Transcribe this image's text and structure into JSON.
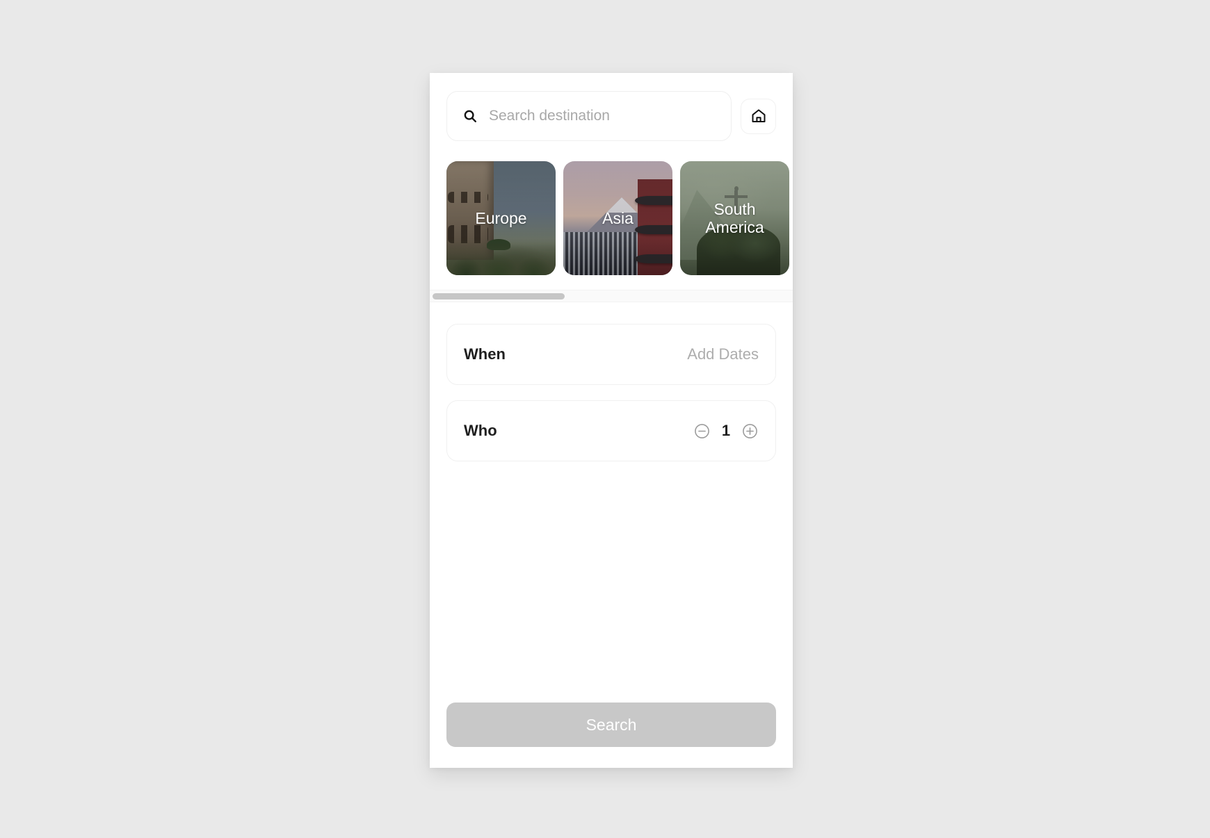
{
  "search": {
    "placeholder": "Search destination",
    "value": "",
    "icon": "search-icon",
    "home_icon": "home-icon"
  },
  "destinations": {
    "items": [
      {
        "label": "Europe",
        "photo": "colosseum-rome"
      },
      {
        "label": "Asia",
        "photo": "mount-fuji-pagoda"
      },
      {
        "label": "South America",
        "photo": "christ-the-redeemer-rio"
      }
    ]
  },
  "scrollbar": {
    "orientation": "horizontal",
    "thumb_position_percent": 0
  },
  "options": {
    "when": {
      "label": "When",
      "value": "Add Dates"
    },
    "who": {
      "label": "Who",
      "count": "1",
      "decrement_icon": "minus-circle-icon",
      "increment_icon": "plus-circle-icon"
    }
  },
  "footer": {
    "search_label": "Search"
  },
  "colors": {
    "page_background": "#e9e9e9",
    "panel_background": "#ffffff",
    "text_primary": "#1f1f1f",
    "text_muted": "#adadad",
    "button_disabled": "#c8c8c8",
    "scroll_thumb": "#c6c6c6"
  }
}
